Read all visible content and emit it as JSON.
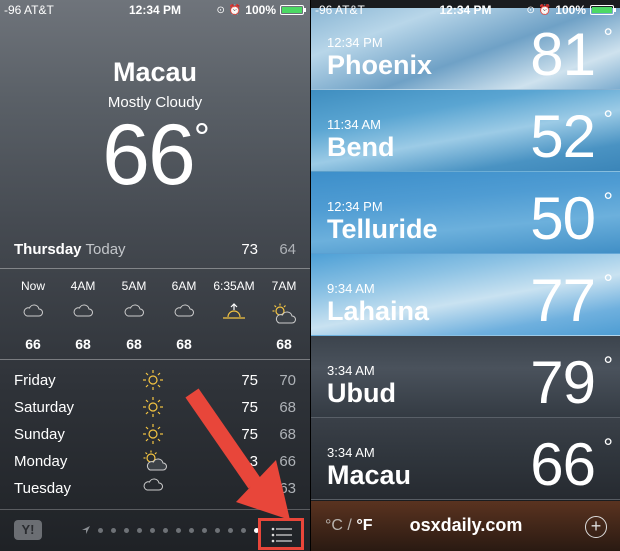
{
  "status_left": {
    "carrier": "-96 AT&T",
    "time": "12:34 PM",
    "battery": "100%"
  },
  "status_right": {
    "carrier": "-96 AT&T",
    "time": "12:34 PM",
    "battery": "100%"
  },
  "current": {
    "city": "Macau",
    "condition": "Mostly Cloudy",
    "temp": "66",
    "degree": "°"
  },
  "today": {
    "day": "Thursday",
    "label": "Today",
    "high": "73",
    "low": "64"
  },
  "hourly": [
    {
      "label": "Now",
      "icon": "cloud-icon",
      "temp": "66"
    },
    {
      "label": "4AM",
      "icon": "cloud-icon",
      "temp": "68"
    },
    {
      "label": "5AM",
      "icon": "cloud-icon",
      "temp": "68"
    },
    {
      "label": "6AM",
      "icon": "cloud-icon",
      "temp": "68"
    },
    {
      "label": "6:35AM",
      "icon": "sunrise-icon",
      "temp": ""
    },
    {
      "label": "7AM",
      "icon": "partly-cloudy-icon",
      "temp": "68"
    }
  ],
  "daily": [
    {
      "day": "Friday",
      "icon": "sun-icon",
      "high": "75",
      "low": "70"
    },
    {
      "day": "Saturday",
      "icon": "sun-icon",
      "high": "75",
      "low": "68"
    },
    {
      "day": "Sunday",
      "icon": "sun-icon",
      "high": "75",
      "low": "68"
    },
    {
      "day": "Monday",
      "icon": "partly-cloudy-icon",
      "high": "3",
      "low": "66"
    },
    {
      "day": "Tuesday",
      "icon": "cloud-icon",
      "high": "2",
      "low": "63"
    }
  ],
  "bottom_left": {
    "yahoo": "Y!"
  },
  "cities": [
    {
      "time": "12:34 PM",
      "name": "Phoenix",
      "temp": "81"
    },
    {
      "time": "11:34 AM",
      "name": "Bend",
      "temp": "52"
    },
    {
      "time": "12:34 PM",
      "name": "Telluride",
      "temp": "50"
    },
    {
      "time": "9:34 AM",
      "name": "Lahaina",
      "temp": "77"
    },
    {
      "time": "3:34 AM",
      "name": "Ubud",
      "temp": "79"
    },
    {
      "time": "3:34 AM",
      "name": "Macau",
      "temp": "66"
    }
  ],
  "bottom_right": {
    "celsius": "°C",
    "slash": "/",
    "fahrenheit": "°F",
    "watermark": "osxdaily.com",
    "add": "+"
  },
  "colors": {
    "highlight": "#e8463a",
    "battery": "#4cd964"
  }
}
